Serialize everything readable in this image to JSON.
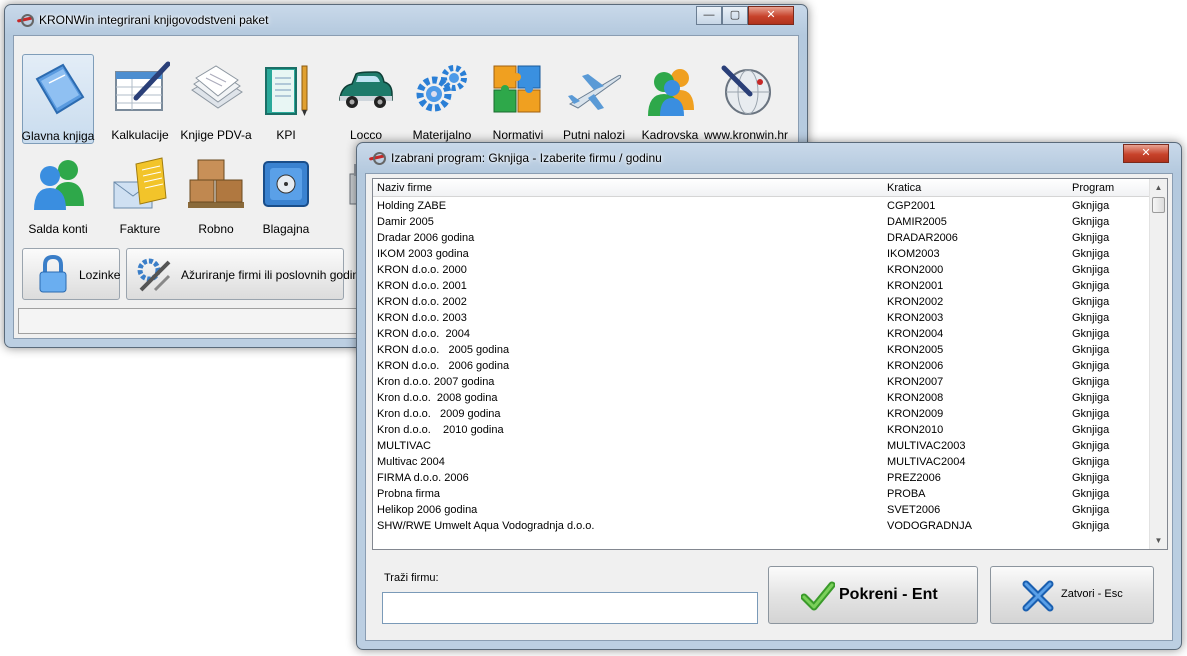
{
  "main_window": {
    "title": "KRONWin integrirani knjigovodstveni paket",
    "controls": {
      "minimize": "—",
      "maximize": "▢",
      "close": "✕"
    },
    "tiles_row1": [
      {
        "label": "Glavna knjiga",
        "icon": "ledger-book-icon"
      },
      {
        "label": "Kalkulacije",
        "icon": "spreadsheet-pen-icon"
      },
      {
        "label": "Knjige PDV-a",
        "icon": "papers-stack-icon"
      },
      {
        "label": "KPI",
        "icon": "notebook-pencil-icon"
      },
      {
        "label": "Locco",
        "icon": "car-icon"
      },
      {
        "label": "Materijalno",
        "icon": "gears-icon"
      },
      {
        "label": "Normativi",
        "icon": "puzzle-icon"
      },
      {
        "label": "Putni nalozi",
        "icon": "airplane-icon"
      },
      {
        "label": "Kadrovska",
        "icon": "people-icon"
      },
      {
        "label": "www.kronwin.hr",
        "icon": "globe-pen-icon"
      }
    ],
    "tiles_row2": [
      {
        "label": "Salda konti",
        "icon": "people-icon"
      },
      {
        "label": "Fakture",
        "icon": "invoice-envelope-icon"
      },
      {
        "label": "Robno",
        "icon": "boxes-pallet-icon"
      },
      {
        "label": "Blagajna",
        "icon": "safe-icon"
      },
      {
        "label": "Pl",
        "icon": "cash-register-icon"
      }
    ],
    "buttons": [
      {
        "label": "Lozinke",
        "icon": "padlock-icon"
      },
      {
        "label": "Ažuriranje firmi ili poslovnih godina",
        "icon": "tools-icon"
      }
    ]
  },
  "dialog": {
    "title": "Izabrani program: Gknjiga - Izaberite firmu / godinu",
    "close": "✕",
    "columns": [
      "Naziv firme",
      "Kratica",
      "Program"
    ],
    "rows": [
      [
        "Holding ZABE",
        "CGP2001",
        "Gknjiga"
      ],
      [
        "Damir 2005",
        "DAMIR2005",
        "Gknjiga"
      ],
      [
        "Dradar 2006 godina",
        "DRADAR2006",
        "Gknjiga"
      ],
      [
        "IKOM 2003 godina",
        "IKOM2003",
        "Gknjiga"
      ],
      [
        "KRON d.o.o. 2000",
        "KRON2000",
        "Gknjiga"
      ],
      [
        "KRON d.o.o. 2001",
        "KRON2001",
        "Gknjiga"
      ],
      [
        "KRON d.o.o. 2002",
        "KRON2002",
        "Gknjiga"
      ],
      [
        "KRON d.o.o. 2003",
        "KRON2003",
        "Gknjiga"
      ],
      [
        "KRON d.o.o.  2004",
        "KRON2004",
        "Gknjiga"
      ],
      [
        "KRON d.o.o.   2005 godina",
        "KRON2005",
        "Gknjiga"
      ],
      [
        "KRON d.o.o.   2006 godina",
        "KRON2006",
        "Gknjiga"
      ],
      [
        "Kron d.o.o. 2007 godina",
        "KRON2007",
        "Gknjiga"
      ],
      [
        "Kron d.o.o.  2008 godina",
        "KRON2008",
        "Gknjiga"
      ],
      [
        "Kron d.o.o.   2009 godina",
        "KRON2009",
        "Gknjiga"
      ],
      [
        "Kron d.o.o.    2010 godina",
        "KRON2010",
        "Gknjiga"
      ],
      [
        "MULTIVAC",
        "MULTIVAC2003",
        "Gknjiga"
      ],
      [
        "Multivac 2004",
        "MULTIVAC2004",
        "Gknjiga"
      ],
      [
        "FIRMA d.o.o. 2006",
        "PREZ2006",
        "Gknjiga"
      ],
      [
        "Probna firma",
        "PROBA",
        "Gknjiga"
      ],
      [
        "Helikop 2006 godina",
        "SVET2006",
        "Gknjiga"
      ],
      [
        "SHW/RWE Umwelt Aqua Vodogradnja d.o.o.",
        "VODOGRADNJA",
        "Gknjiga"
      ]
    ],
    "search_label": "Traži firmu:",
    "search_value": "",
    "start_button": "Pokreni - Ent",
    "close_button": "Zatvori - Esc"
  }
}
